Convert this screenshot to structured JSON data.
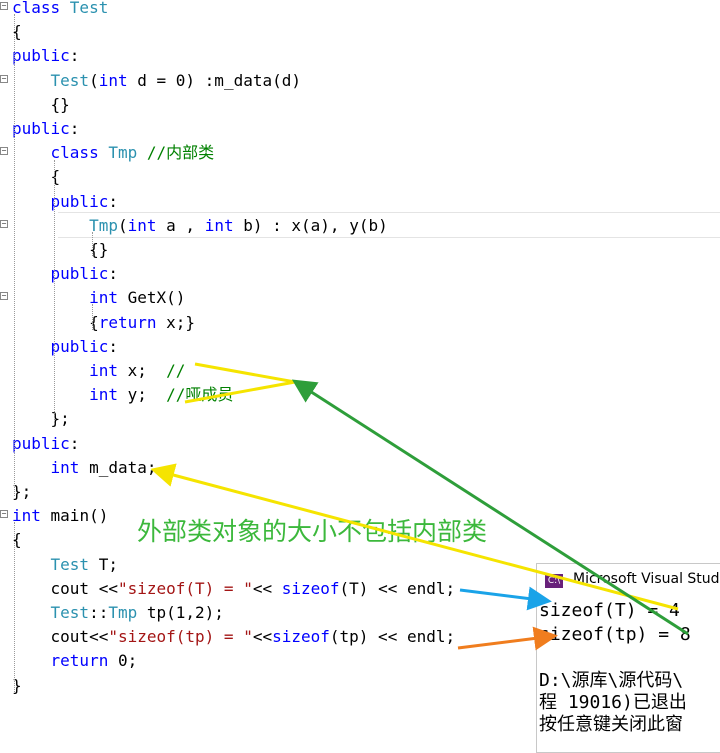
{
  "code_lines": [
    [
      {
        "t": "class ",
        "c": "kw"
      },
      {
        "t": "Test",
        "c": "ty"
      }
    ],
    [
      {
        "t": "{",
        "c": ""
      }
    ],
    [
      {
        "t": "public",
        "c": "kw"
      },
      {
        "t": ":",
        "c": ""
      }
    ],
    [
      {
        "t": "    ",
        "c": ""
      },
      {
        "t": "Test",
        "c": "ty"
      },
      {
        "t": "(",
        "c": ""
      },
      {
        "t": "int",
        "c": "kw"
      },
      {
        "t": " d = 0) :m_data(d)",
        "c": ""
      }
    ],
    [
      {
        "t": "    {}",
        "c": ""
      }
    ],
    [
      {
        "t": "public",
        "c": "kw"
      },
      {
        "t": ":",
        "c": ""
      }
    ],
    [
      {
        "t": "    ",
        "c": ""
      },
      {
        "t": "class ",
        "c": "kw"
      },
      {
        "t": "Tmp ",
        "c": "ty"
      },
      {
        "t": "//内部类",
        "c": "cm"
      }
    ],
    [
      {
        "t": "    {",
        "c": ""
      }
    ],
    [
      {
        "t": "    ",
        "c": ""
      },
      {
        "t": "public",
        "c": "kw"
      },
      {
        "t": ":",
        "c": ""
      }
    ],
    [
      {
        "t": "        ",
        "c": ""
      },
      {
        "t": "Tmp",
        "c": "ty"
      },
      {
        "t": "(",
        "c": ""
      },
      {
        "t": "int",
        "c": "kw"
      },
      {
        "t": " a , ",
        "c": ""
      },
      {
        "t": "int",
        "c": "kw"
      },
      {
        "t": " b) : x(a), y(b)",
        "c": ""
      }
    ],
    [
      {
        "t": "        {}",
        "c": ""
      }
    ],
    [
      {
        "t": "    ",
        "c": ""
      },
      {
        "t": "public",
        "c": "kw"
      },
      {
        "t": ":",
        "c": ""
      }
    ],
    [
      {
        "t": "        ",
        "c": ""
      },
      {
        "t": "int",
        "c": "kw"
      },
      {
        "t": " GetX()",
        "c": ""
      }
    ],
    [
      {
        "t": "        {",
        "c": ""
      },
      {
        "t": "return",
        "c": "kw"
      },
      {
        "t": " x;}",
        "c": ""
      }
    ],
    [
      {
        "t": "    ",
        "c": ""
      },
      {
        "t": "public",
        "c": "kw"
      },
      {
        "t": ":",
        "c": ""
      }
    ],
    [
      {
        "t": "        ",
        "c": ""
      },
      {
        "t": "int",
        "c": "kw"
      },
      {
        "t": " x;  ",
        "c": ""
      },
      {
        "t": "//",
        "c": "cm"
      }
    ],
    [
      {
        "t": "        ",
        "c": ""
      },
      {
        "t": "int",
        "c": "kw"
      },
      {
        "t": " y;  ",
        "c": ""
      },
      {
        "t": "//哑成员",
        "c": "cm"
      }
    ],
    [
      {
        "t": "    };",
        "c": ""
      }
    ],
    [
      {
        "t": "public",
        "c": "kw"
      },
      {
        "t": ":",
        "c": ""
      }
    ],
    [
      {
        "t": "    ",
        "c": ""
      },
      {
        "t": "int",
        "c": "kw"
      },
      {
        "t": " m_data;",
        "c": ""
      }
    ],
    [
      {
        "t": "};",
        "c": ""
      }
    ],
    [
      {
        "t": "int",
        "c": "kw"
      },
      {
        "t": " main()",
        "c": ""
      }
    ],
    [
      {
        "t": "{",
        "c": ""
      }
    ],
    [
      {
        "t": "    ",
        "c": ""
      },
      {
        "t": "Test",
        "c": "ty"
      },
      {
        "t": " T;",
        "c": ""
      }
    ],
    [
      {
        "t": "    cout <<",
        "c": ""
      },
      {
        "t": "\"sizeof(T) = \"",
        "c": "str"
      },
      {
        "t": "<< ",
        "c": ""
      },
      {
        "t": "sizeof",
        "c": "kw"
      },
      {
        "t": "(T) << endl;",
        "c": ""
      }
    ],
    [
      {
        "t": "    ",
        "c": ""
      },
      {
        "t": "Test",
        "c": "ty"
      },
      {
        "t": "::",
        "c": ""
      },
      {
        "t": "Tmp",
        "c": "ty"
      },
      {
        "t": " tp(1,2);",
        "c": ""
      }
    ],
    [
      {
        "t": "    cout<<",
        "c": ""
      },
      {
        "t": "\"sizeof(tp) = \"",
        "c": "str"
      },
      {
        "t": "<<",
        "c": ""
      },
      {
        "t": "sizeof",
        "c": "kw"
      },
      {
        "t": "(tp) << endl;",
        "c": ""
      }
    ],
    [
      {
        "t": "    ",
        "c": ""
      },
      {
        "t": "return",
        "c": "kw"
      },
      {
        "t": " 0;",
        "c": ""
      }
    ],
    [
      {
        "t": "}",
        "c": ""
      }
    ]
  ],
  "annotation": "外部类对象的大小不包括内部类",
  "console": {
    "title": "Microsoft Visual Stud",
    "lines": [
      "sizeof(T) = 4",
      "sizeof(tp) = 8",
      "",
      "D:\\源库\\源代码\\",
      "程 19016)已退出",
      "按任意键关闭此窗"
    ]
  },
  "colors": {
    "keyword": "#0000ff",
    "type": "#2b91af",
    "string": "#a31515",
    "comment": "#008000",
    "arrow_yellow": "#f5e400",
    "arrow_green": "#2e9e3a",
    "arrow_blue": "#1aa3e8",
    "arrow_orange": "#f07d1e"
  }
}
